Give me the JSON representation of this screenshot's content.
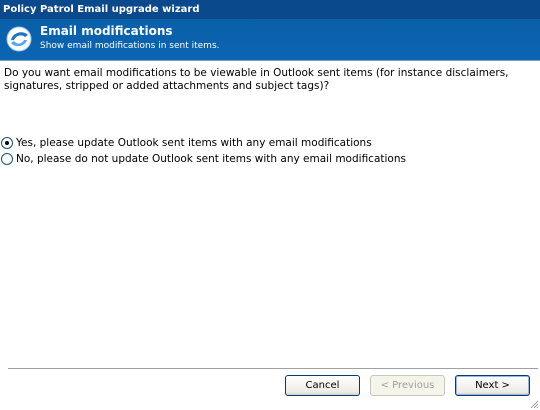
{
  "window": {
    "title": "Policy Patrol Email upgrade wizard"
  },
  "banner": {
    "icon": "policy-patrol-logo-icon",
    "title": "Email modifications",
    "subtitle": "Show email modifications in sent items."
  },
  "question": "Do you want email modifications to be viewable in Outlook sent items (for instance disclaimers, signatures, stripped or added attachments and subject tags)?",
  "options": [
    {
      "label": "Yes, please update Outlook sent items with any email modifications",
      "selected": true
    },
    {
      "label": "No, please do not update Outlook sent items with any email modifications",
      "selected": false
    }
  ],
  "buttons": {
    "cancel": "Cancel",
    "previous": "< Previous",
    "next": "Next >"
  },
  "colors": {
    "titlebar": "#0a4a8c",
    "banner": "#0b65b3"
  }
}
